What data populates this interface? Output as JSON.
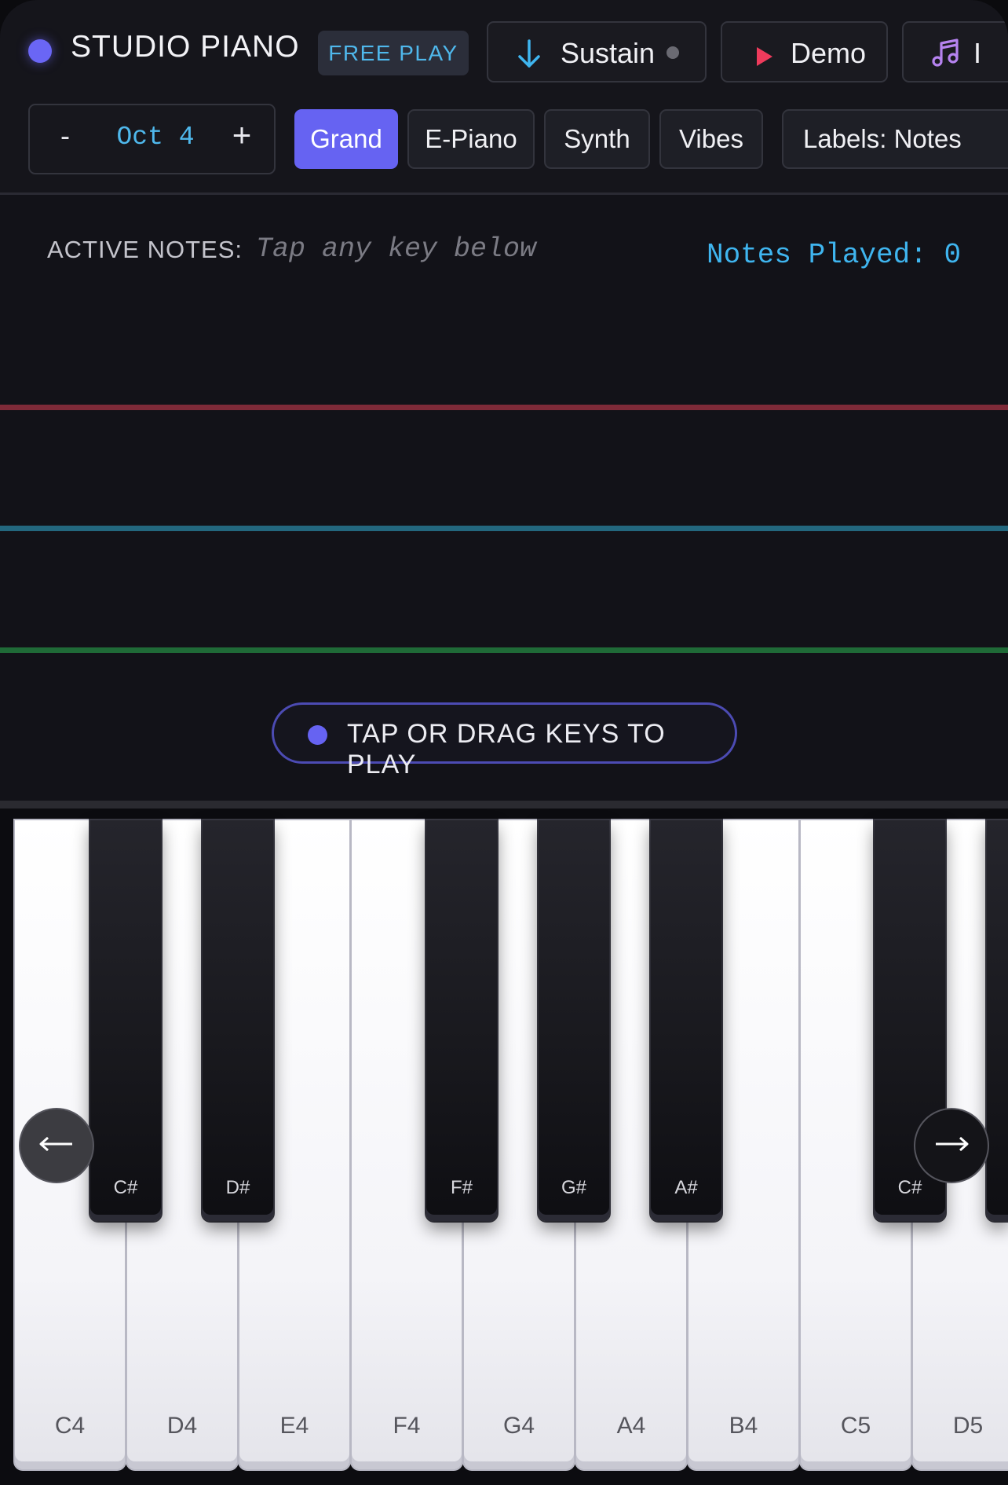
{
  "header": {
    "title": "STUDIO PIANO",
    "mode_badge": "FREE PLAY",
    "sustain_label": "Sustain",
    "demo_label": "Demo",
    "extra_label": "I"
  },
  "octave": {
    "minus": "-",
    "value": "Oct 4",
    "plus": "+"
  },
  "instruments": [
    {
      "label": "Grand",
      "active": true
    },
    {
      "label": "E-Piano",
      "active": false
    },
    {
      "label": "Synth",
      "active": false
    },
    {
      "label": "Vibes",
      "active": false
    }
  ],
  "labels_toggle": "Labels: Notes",
  "display": {
    "active_notes_label": "ACTIVE NOTES:",
    "active_notes_hint": "Tap any key below",
    "notes_played": "Notes Played: 0",
    "hint": "TAP OR DRAG KEYS TO PLAY"
  },
  "keys": {
    "white": [
      "C4",
      "D4",
      "E4",
      "F4",
      "G4",
      "A4",
      "B4",
      "C5",
      "D5"
    ],
    "black": [
      "C#",
      "D#",
      "F#",
      "G#",
      "A#",
      "C#",
      ""
    ]
  },
  "nav": {
    "left": "←",
    "right": "→"
  },
  "colors": {
    "accent": "#6663f2",
    "info": "#3fb5ef",
    "line_red": "#7e2a38",
    "line_blue": "#23677e",
    "line_green": "#1f6a37",
    "play_icon": "#ef3b5c",
    "music_icon": "#b683f0"
  },
  "icons": {
    "sustain": "arrow-down-icon",
    "demo": "play-icon",
    "extra": "music-note-icon",
    "brand": "status-dot-icon"
  }
}
